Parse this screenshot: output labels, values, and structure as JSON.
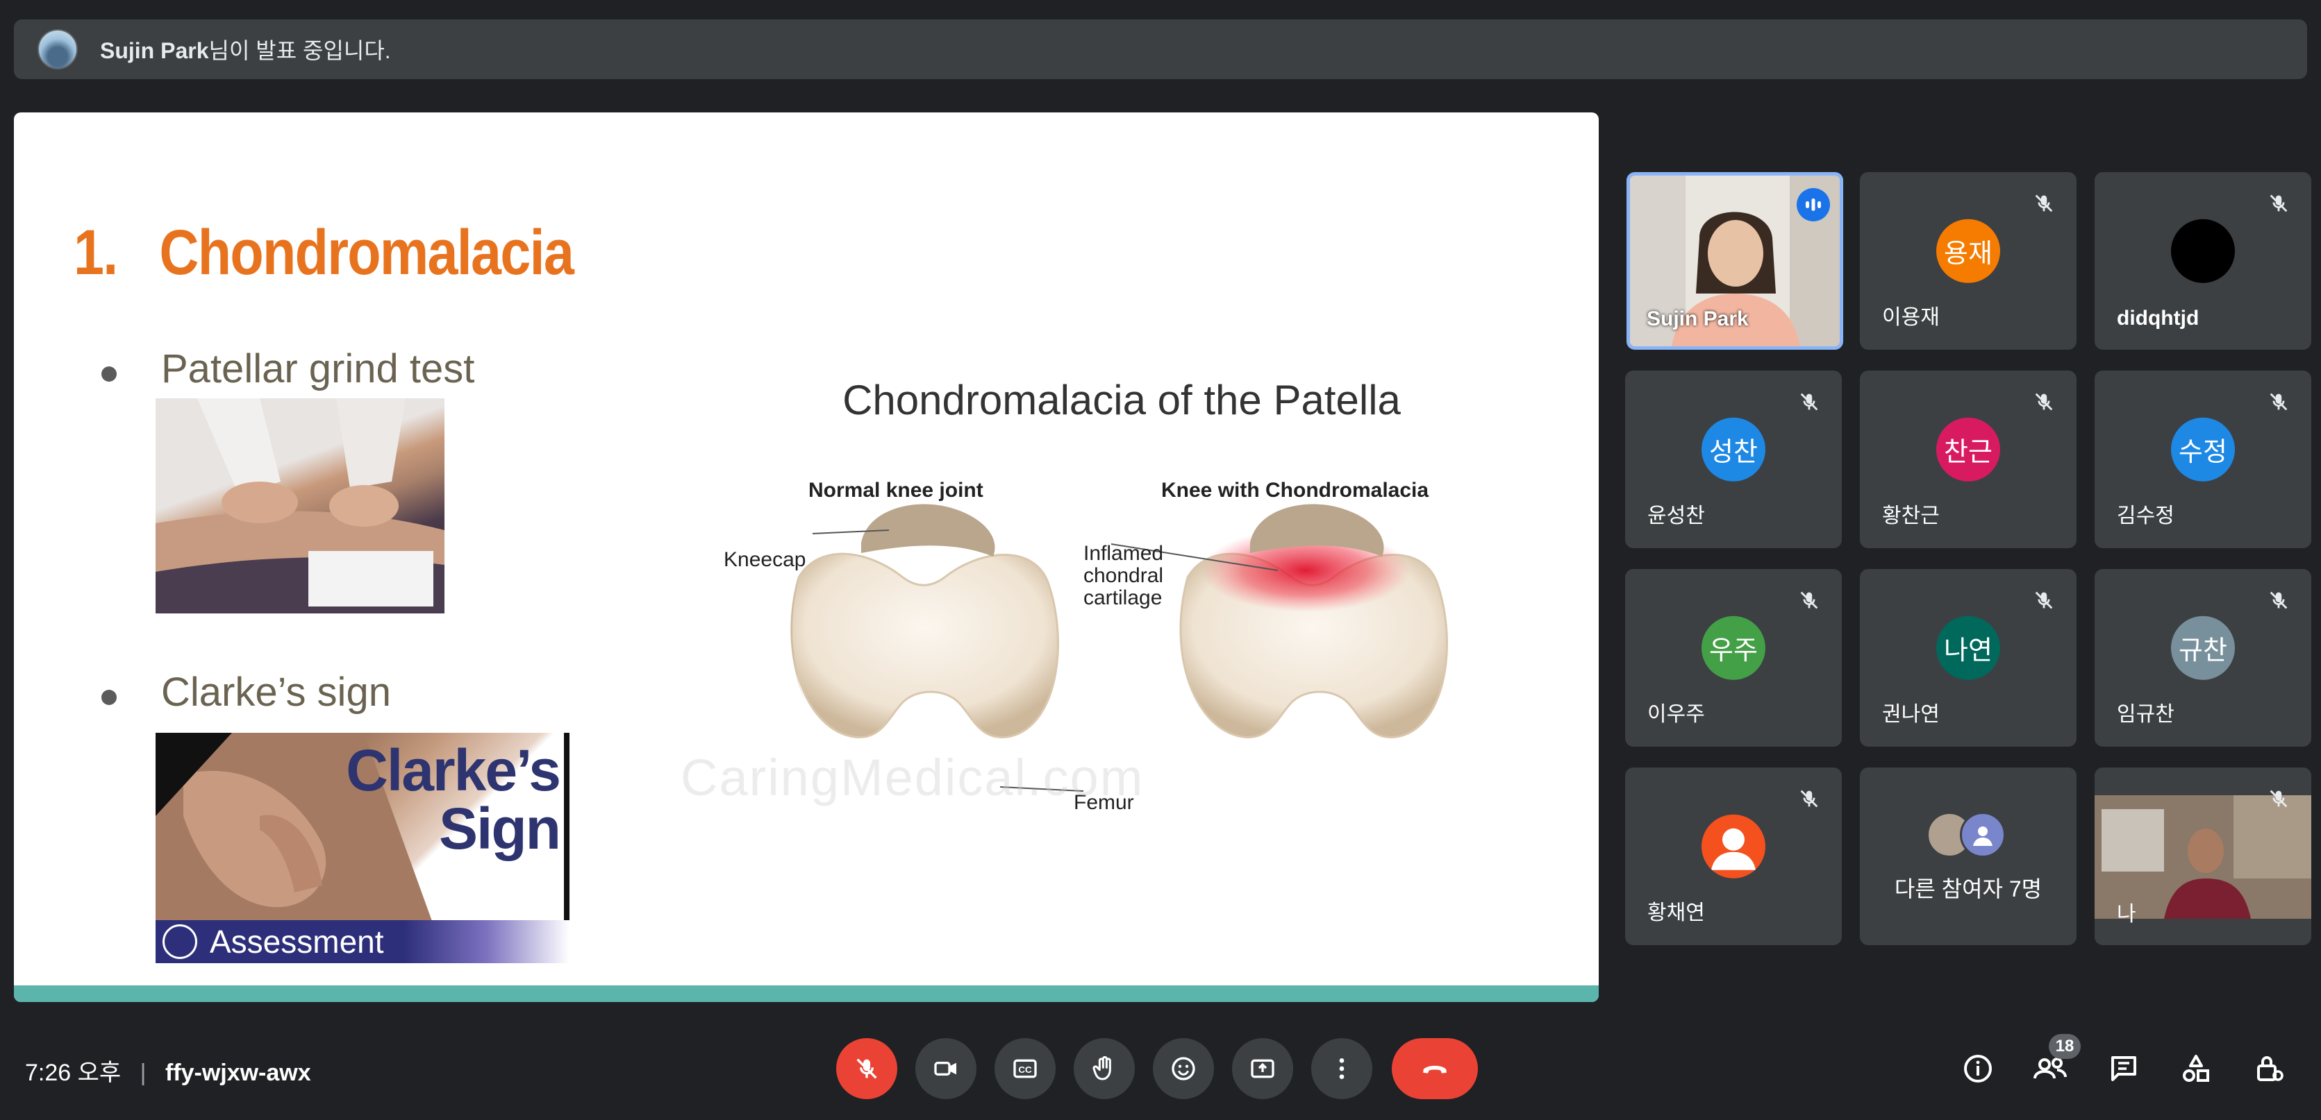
{
  "banner": {
    "presenter_name": "Sujin Park",
    "presenting_suffix": "님이 발표 중입니다."
  },
  "slide": {
    "title": "1.   Chondromalacia",
    "bullets": [
      "Patellar grind test",
      "Clarke’s sign"
    ],
    "clarke_image_text": "Clarke’s\nSign",
    "assessment_label": "Assessment",
    "diagram": {
      "title": "Chondromalacia of the Patella",
      "normal_heading": "Normal knee joint",
      "chondro_heading": "Knee with Chondromalacia",
      "kneecap_label": "Kneecap",
      "femur_label": "Femur",
      "inflamed_label": "Inflamed\nchondral\ncartilage"
    },
    "watermark": "CaringMedical.com"
  },
  "participants": [
    {
      "name": "Sujin Park",
      "initials": "",
      "avatar_color": "",
      "video": true,
      "speaking": true,
      "muted": false
    },
    {
      "name": "이용재",
      "initials": "용재",
      "avatar_color": "#f57c00",
      "video": false,
      "muted": true
    },
    {
      "name": "didqhtjd",
      "initials": "",
      "avatar_color": "#000000",
      "video": false,
      "muted": true
    },
    {
      "name": "윤성찬",
      "initials": "성찬",
      "avatar_color": "#1e88e5",
      "video": false,
      "muted": true
    },
    {
      "name": "황찬근",
      "initials": "찬근",
      "avatar_color": "#d81b60",
      "video": false,
      "muted": true
    },
    {
      "name": "김수정",
      "initials": "수정",
      "avatar_color": "#1e88e5",
      "video": false,
      "muted": true
    },
    {
      "name": "이우주",
      "initials": "우주",
      "avatar_color": "#43a047",
      "video": false,
      "muted": true
    },
    {
      "name": "권나연",
      "initials": "나연",
      "avatar_color": "#00695c",
      "video": false,
      "muted": true
    },
    {
      "name": "임규찬",
      "initials": "규찬",
      "avatar_color": "#78909c",
      "video": false,
      "muted": true
    },
    {
      "name": "황채연",
      "initials": "",
      "avatar_color": "#f4511e",
      "video": false,
      "muted": true
    },
    {
      "name": "다른 참여자 7명",
      "initials": "",
      "avatar_color": "",
      "video": false,
      "muted": false
    },
    {
      "name": "나",
      "initials": "",
      "avatar_color": "",
      "video": true,
      "muted": true
    }
  ],
  "bottom_bar": {
    "time": "7:26 오후",
    "separator": "|",
    "meeting_code": "ffy-wjxw-awx",
    "people_count": "18"
  },
  "icons": [
    "mic-off-icon",
    "camera-icon",
    "captions-icon",
    "raise-hand-icon",
    "emoji-icon",
    "present-icon",
    "more-icon",
    "end-call-icon",
    "info-icon",
    "people-icon",
    "chat-icon",
    "activities-icon",
    "host-controls-icon"
  ],
  "colors": {
    "background": "#202124",
    "tile": "#3c4043",
    "end_call": "#ea4335",
    "mic_off_button": "#ea4335",
    "speaking_border": "#8ab4f8",
    "title_orange": "#e8731f",
    "slide_accent": "#5bb5ad"
  }
}
